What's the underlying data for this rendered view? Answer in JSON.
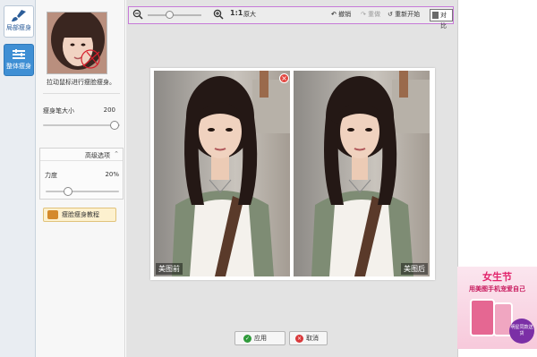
{
  "sidebar": {
    "items": [
      {
        "label": "局部瘦身",
        "icon": "brush-icon",
        "active": true
      },
      {
        "label": "整体瘦身",
        "icon": "sliders-icon",
        "active": false
      }
    ]
  },
  "panel": {
    "thumb_caption": "拉动鼠标进行瘦脸瘦身。",
    "brush_size": {
      "label": "瘦身笔大小",
      "value": "200",
      "level": 1.0
    },
    "advanced": {
      "title": "高级选项",
      "strength": {
        "label": "力度",
        "value": "20%",
        "level": 0.2
      }
    },
    "tutorial_label": "瘦脸瘦身教程"
  },
  "toolbar": {
    "zoom_out_icon": "zoom-out-icon",
    "zoom_in_icon": "zoom-in-icon",
    "zoom_level": 0.42,
    "actual_size_ratio": "1:1",
    "actual_size_label": "原大",
    "undo_label": "撤销",
    "redo_label": "重做",
    "reset_label": "重新开始",
    "compare_label": "对比"
  },
  "preview": {
    "before_label": "美图前",
    "after_label": "美图后"
  },
  "actions": {
    "apply_label": "应用",
    "cancel_label": "取消"
  },
  "ad": {
    "title": "女生节",
    "subtitle": "用美图手机宠爱自己",
    "badge": "明星同款送货"
  },
  "colors": {
    "accent": "#3f8fd4",
    "toolbar_border": "#c77ad8",
    "apply": "#2f9a3b",
    "cancel": "#d9383a",
    "ad_pink": "#e2246c"
  }
}
